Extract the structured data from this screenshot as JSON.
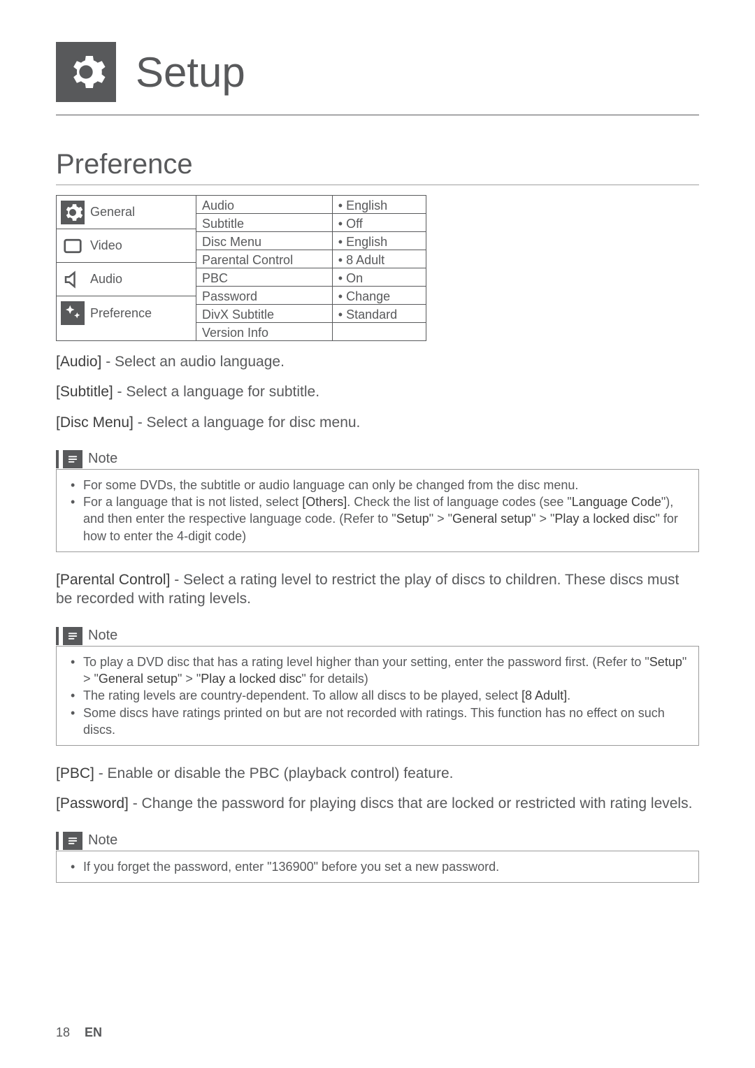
{
  "header": {
    "title": "Setup"
  },
  "section": {
    "heading": "Preference"
  },
  "menu": {
    "left": [
      {
        "label": "General"
      },
      {
        "label": "Video"
      },
      {
        "label": "Audio"
      },
      {
        "label": "Preference"
      }
    ],
    "rows": [
      {
        "name": "Audio",
        "value": "• English"
      },
      {
        "name": "Subtitle",
        "value": "• Off"
      },
      {
        "name": "Disc Menu",
        "value": "• English"
      },
      {
        "name": "Parental Control",
        "value": "• 8 Adult"
      },
      {
        "name": "PBC",
        "value": "• On"
      },
      {
        "name": "Password",
        "value": "• Change"
      },
      {
        "name": "DivX Subtitle",
        "value": "• Standard"
      },
      {
        "name": "Version Info",
        "value": ""
      }
    ]
  },
  "body": {
    "audio_b": "[Audio]",
    "audio_t": " - Select an audio language.",
    "subtitle_b": "[Subtitle]",
    "subtitle_t": " - Select a language for subtitle.",
    "discmenu_b": "[Disc Menu]",
    "discmenu_t": " - Select a language for disc menu.",
    "parental_b": "[Parental Control]",
    "parental_t": " - Select a rating level to restrict the play of discs to children. These discs must be recorded with rating levels.",
    "pbc_b": "[PBC]",
    "pbc_t": " - Enable or disable the PBC (playback control) feature.",
    "password_b": "[Password]",
    "password_t": " - Change the password for playing discs that are locked or restricted with rating levels."
  },
  "notes": {
    "label": "Note",
    "n1": {
      "li1": "For some DVDs, the subtitle or audio language can only be changed from the disc menu.",
      "li2a": "For a language that is not listed, select ",
      "li2b": "[Others]",
      "li2c": ". Check the list of language codes (see \"",
      "li2d": "Language Code",
      "li2e": "\"), and then enter the respective language code. (Refer to \"",
      "li2f": "Setup",
      "li2g": "\" > \"",
      "li2h": "General setup",
      "li2i": "\" > \"",
      "li2j": "Play a locked disc",
      "li2k": "\" for how to enter the 4-digit code)"
    },
    "n2": {
      "li1a": "To play a DVD disc that has a rating level higher than your setting, enter the password first. (Refer to \"",
      "li1b": "Setup",
      "li1c": "\" > \"",
      "li1d": "General setup",
      "li1e": "\" > \"",
      "li1f": "Play a locked disc",
      "li1g": "\" for details)",
      "li2a": "The rating levels are country-dependent. To allow all discs to be played, select ",
      "li2b": "[8 Adult]",
      "li2c": ".",
      "li3": "Some discs have ratings printed on but are not recorded with ratings. This function has no effect on such discs."
    },
    "n3": {
      "li1": "If you forget the password, enter \"136900\" before you set a new password."
    }
  },
  "footer": {
    "page": "18",
    "lang": "EN"
  }
}
